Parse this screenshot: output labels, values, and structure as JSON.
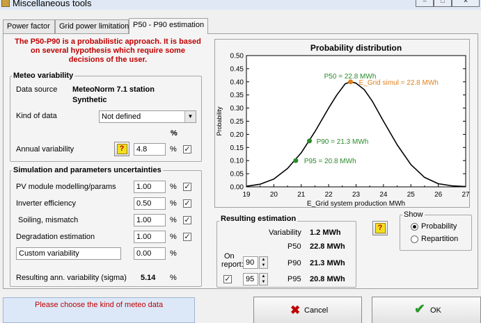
{
  "window": {
    "title": "Miscellaneous tools"
  },
  "tabs": [
    {
      "label": "Power factor"
    },
    {
      "label": "Grid power limitation"
    },
    {
      "label": "P50 - P90 estimation"
    }
  ],
  "warning": "The P50-P90 is a probabilistic approach. It is based on several hypothesis which require some decisions of the user.",
  "meteo": {
    "title": "Meteo variability",
    "data_source_label": "Data source",
    "data_source_value_1": "MeteoNorm 7.1 station",
    "data_source_value_2": "Synthetic",
    "kind_label": "Kind of data",
    "kind_value": "Not defined",
    "percent_header": "%",
    "annual_label": "Annual variability",
    "annual_value": "4.8",
    "annual_unit": "%",
    "annual_checked": true
  },
  "sim": {
    "title": "Simulation and parameters uncertainties",
    "rows": [
      {
        "label": "PV module modelling/params",
        "value": "1.00",
        "unit": "%",
        "checked": true
      },
      {
        "label": "Inverter efficiency",
        "value": "0.50",
        "unit": "%",
        "checked": true
      },
      {
        "label": "Soiling, mismatch",
        "value": "1.00",
        "unit": "%",
        "checked": true
      },
      {
        "label": "Degradation estimation",
        "value": "1.00",
        "unit": "%",
        "checked": true
      }
    ],
    "custom_label": "Custom variability",
    "custom_value": "0.00",
    "custom_unit": "%",
    "result_label": "Resulting ann. variability (sigma)",
    "result_value": "5.14",
    "result_unit": "%"
  },
  "chart_data": {
    "type": "line",
    "title": "Probability distribution",
    "xlabel": "E_Grid system production MWh",
    "ylabel": "Probability",
    "xlim": [
      19,
      27
    ],
    "ylim": [
      0,
      0.5
    ],
    "x_ticks": [
      "19",
      "20",
      "21",
      "22",
      "23",
      "24",
      "25",
      "26",
      "27"
    ],
    "y_ticks": [
      "0.00",
      "0.05",
      "0.10",
      "0.15",
      "0.20",
      "0.25",
      "0.30",
      "0.35",
      "0.40",
      "0.45",
      "0.50"
    ],
    "series": [
      {
        "x": [
          19.0,
          19.5,
          20.0,
          20.5,
          21.0,
          21.5,
          22.0,
          22.3,
          22.6,
          22.8,
          23.0,
          23.3,
          23.6,
          24.0,
          24.5,
          25.0,
          25.5,
          26.0,
          26.5,
          27.0
        ],
        "y": [
          0.002,
          0.01,
          0.03,
          0.07,
          0.13,
          0.21,
          0.3,
          0.35,
          0.392,
          0.4,
          0.395,
          0.37,
          0.325,
          0.25,
          0.16,
          0.085,
          0.036,
          0.012,
          0.004,
          0.001
        ]
      }
    ],
    "markers": [
      {
        "label": "P50 = 22.8 MWh",
        "x": 22.8,
        "y": 0.4,
        "color": "#e08020"
      },
      {
        "label": "E_Grid simul = 22.8 MWh",
        "x": 22.8,
        "y": 0.4,
        "color": "#e08020"
      },
      {
        "label": "P90 = 21.3 MWh",
        "x": 21.3,
        "y": 0.175,
        "color": "#2a8a2a"
      },
      {
        "label": "P95 = 20.8 MWh",
        "x": 20.8,
        "y": 0.1,
        "color": "#2a8a2a"
      }
    ],
    "label_colors": {
      "p50": "#2a8a2a",
      "simul": "#e08020",
      "p90": "#2a8a2a",
      "p95": "#2a8a2a"
    }
  },
  "result": {
    "title": "Resulting estimation",
    "variability_label": "Variability",
    "variability_value": "1.2 MWh",
    "p50_label": "P50",
    "p50_value": "22.8 MWh",
    "p90_label": "P90",
    "p90_value": "21.3 MWh",
    "p95_label": "P95",
    "p95_value": "20.8 MWh",
    "on_report_1": "On",
    "on_report_2": "report:",
    "report_p90": "90",
    "report_p95": "95",
    "report_checked": true
  },
  "show": {
    "title": "Show",
    "options": [
      "Probability",
      "Repartition"
    ],
    "selected": "Probability"
  },
  "status_text": "Please choose the kind of meteo data",
  "buttons": {
    "cancel": "Cancel",
    "ok": "OK"
  },
  "colors": {
    "warning": "#c00000",
    "accent_green": "#2a8a2a",
    "accent_orange": "#e08020"
  }
}
